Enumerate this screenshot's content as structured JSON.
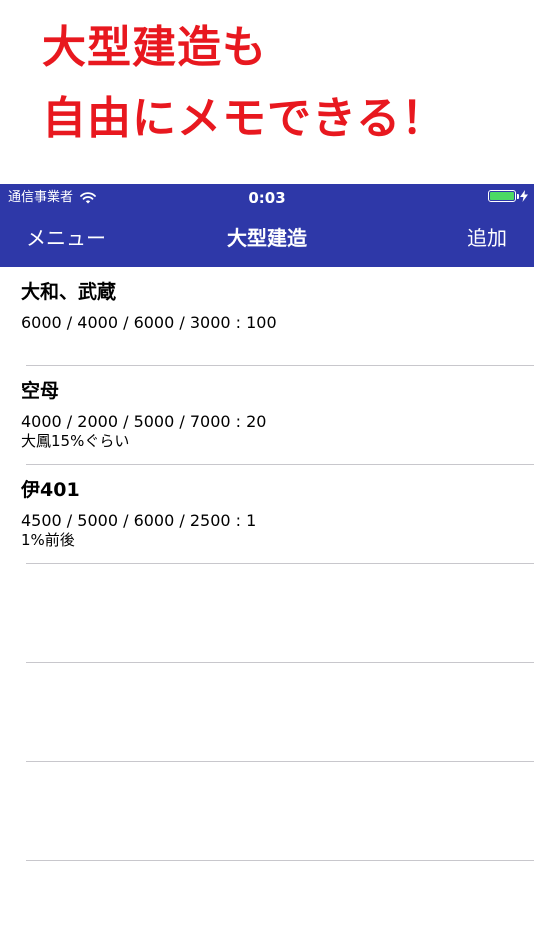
{
  "promo": {
    "line1": "大型建造も",
    "line2": "自由にメモできる！"
  },
  "status_bar": {
    "carrier": "通信事業者",
    "time": "0:03",
    "battery_color": "#4cd964"
  },
  "nav": {
    "left_label": "メニュー",
    "title": "大型建造",
    "right_label": "追加",
    "background": "#2e38a8"
  },
  "entries": [
    {
      "title": "大和、武蔵",
      "numbers": "6000 / 4000 / 6000 / 3000 : 100",
      "memo": ""
    },
    {
      "title": "空母",
      "numbers": "4000 / 2000 / 5000 / 7000 : 20",
      "memo": "大鳳15%ぐらい"
    },
    {
      "title": "伊401",
      "numbers": "4500 / 5000 / 6000 / 2500 : 1",
      "memo": "1%前後"
    }
  ]
}
